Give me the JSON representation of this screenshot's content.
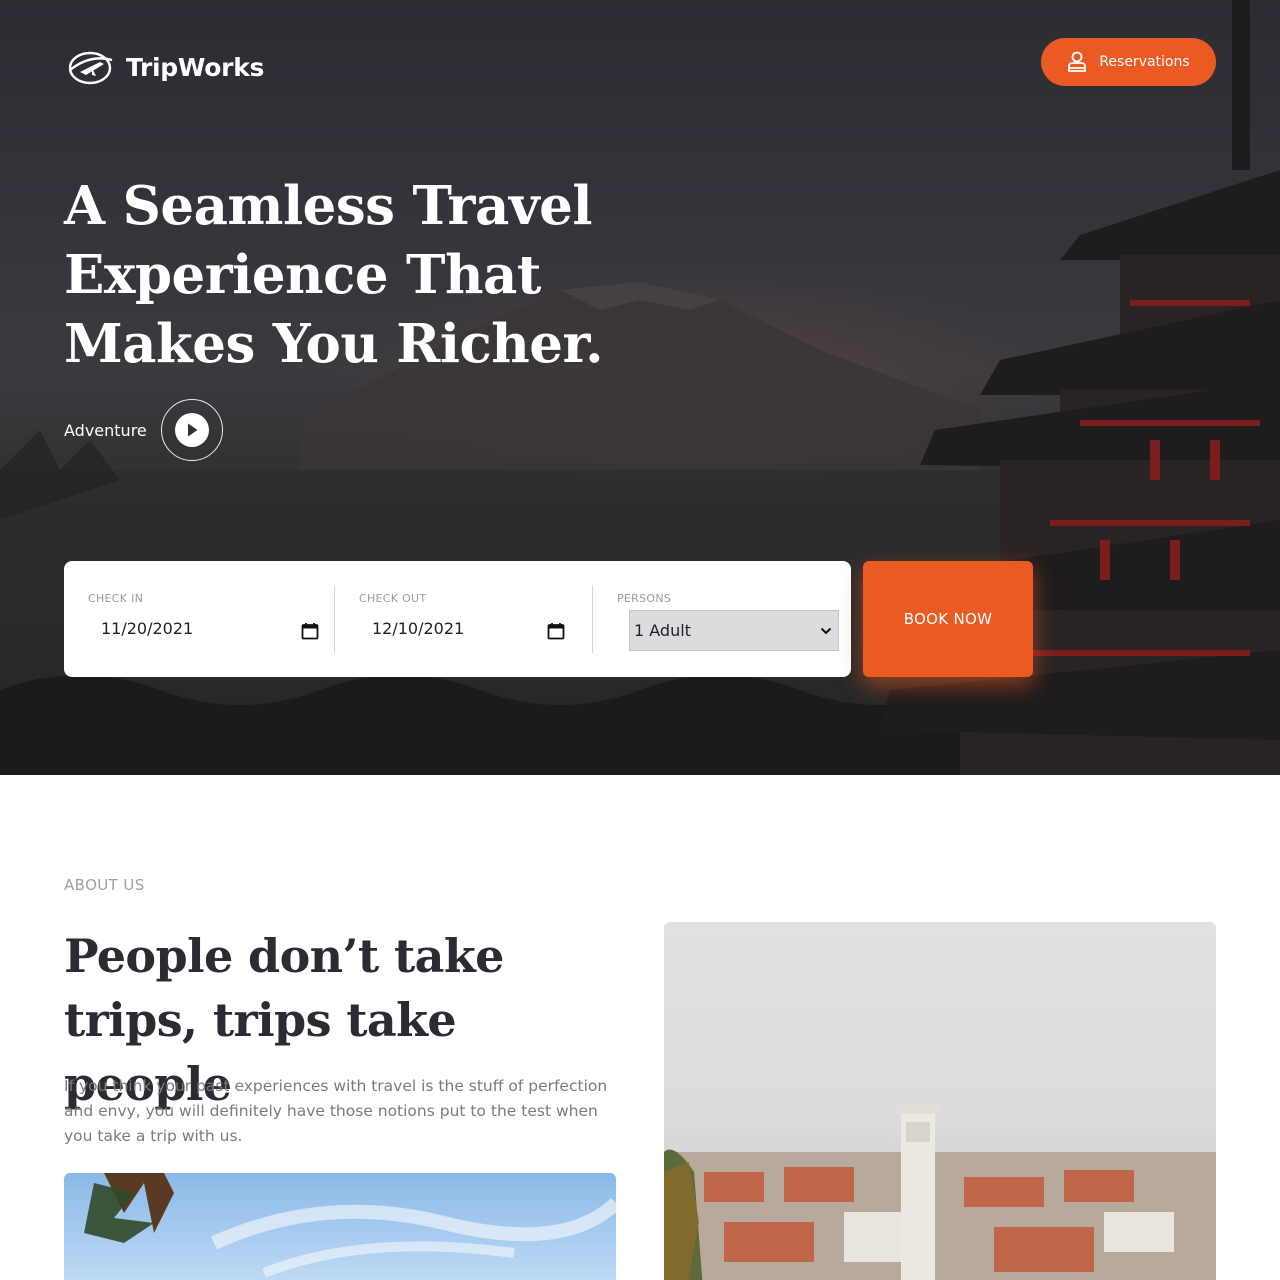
{
  "brand": {
    "name": "TripWorks"
  },
  "header": {
    "reservations_label": "Reservations"
  },
  "hero": {
    "title": "A Seamless Travel Experience That Makes You Richer.",
    "adventure_label": "Adventure"
  },
  "booking": {
    "check_in": {
      "label": "CHECK IN",
      "value": "11/20/2021"
    },
    "check_out": {
      "label": "CHECK OUT",
      "value": "12/10/2021"
    },
    "persons": {
      "label": "PERSONS",
      "value": "1 Adult"
    },
    "book_label": "BOOK NOW"
  },
  "about": {
    "eyebrow": "ABOUT US",
    "title": "People don’t take trips, trips take people",
    "text": "If you think your past experiences with travel is the stuff of perfection and envy, you will definitely have those notions put to the test when you take a trip with us."
  },
  "colors": {
    "accent": "#ea5a22",
    "hero_overlay": "#2f2f35",
    "heading": "#2b2b33",
    "muted": "#9aa0ad"
  },
  "icons": {
    "logo": "globe-plane-icon",
    "reservations": "person-icon",
    "play": "play-icon",
    "calendar": "calendar-icon",
    "select": "chevron-down-icon"
  }
}
